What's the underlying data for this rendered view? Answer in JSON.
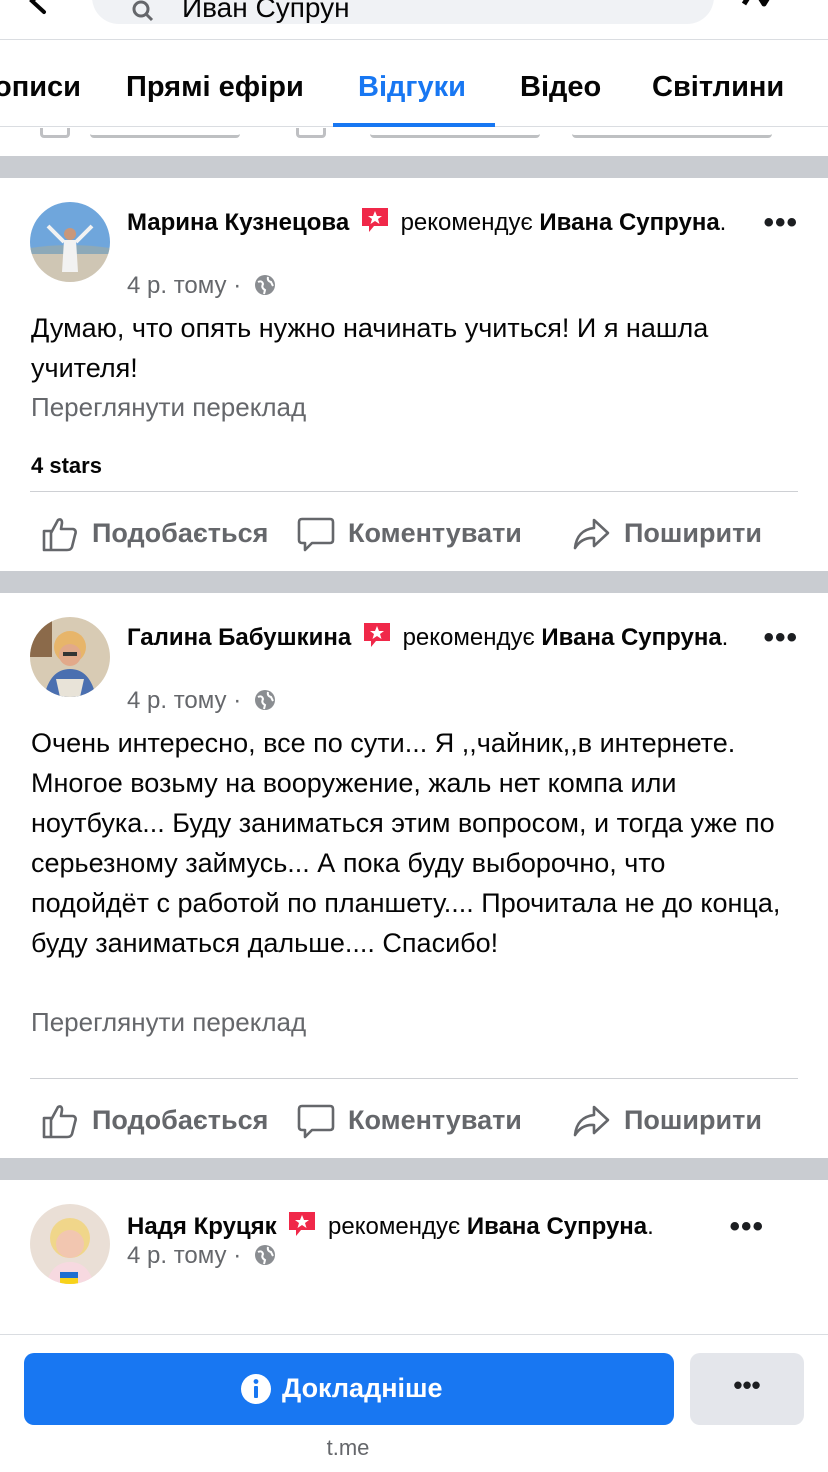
{
  "search": {
    "query": "Иван Супрун"
  },
  "tabs": [
    {
      "label": "описи",
      "active": false
    },
    {
      "label": "Прямі ефіри",
      "active": false
    },
    {
      "label": "Відгуки",
      "active": true
    },
    {
      "label": "Відео",
      "active": false
    },
    {
      "label": "Світлини",
      "active": false
    }
  ],
  "colors": {
    "accent": "#1877f2",
    "badge": "#f02849",
    "muted": "#65676b",
    "separator": "#c9ccd1"
  },
  "actions": {
    "like": "Подобається",
    "comment": "Коментувати",
    "share": "Поширити"
  },
  "posts": [
    {
      "author": "Марина Кузнецова",
      "recommends": "рекомендує",
      "target": "Ивана Супруна",
      "punct": ".",
      "time": "4 р. тому",
      "separator": "·",
      "text": "Думаю, что опять нужно начинать учиться! И я нашла учителя!",
      "translate": "Переглянути переклад",
      "rating": "4 stars"
    },
    {
      "author": "Галина Бабушкина",
      "recommends": "рекомендує",
      "target": "Ивана Супруна",
      "punct": ".",
      "time": "4 р. тому",
      "separator": "·",
      "text": "Очень интересно, все по сути... Я ,,чайник,,в интернете. Многое возьму на вооружение, жаль нет компа или ноутбука... Буду заниматься этим вопросом, и тогда уже по серьезному займусь... А пока буду выборочно, что подойдёт с работой по планшету.... Прочитала не до конца, буду заниматься дальше.... Спасибо!",
      "translate": "Переглянути переклад"
    },
    {
      "author": "Надя Круцяк",
      "recommends": "рекомендує",
      "target": "Ивана Супруна",
      "punct": ".",
      "time": "4 р. тому",
      "separator": "·"
    }
  ],
  "more_dots": "•••",
  "bottom": {
    "cta_label": "Докладніше",
    "more_label": "•••",
    "domain": "t.me"
  }
}
